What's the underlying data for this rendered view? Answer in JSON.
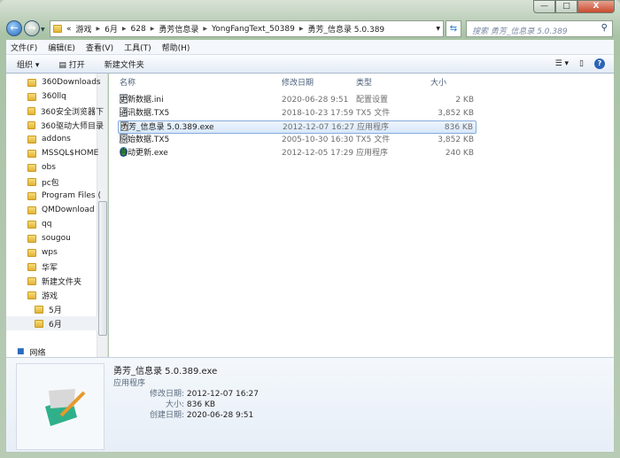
{
  "window": {
    "minimize": "—",
    "maximize": "□",
    "close": "X"
  },
  "address": {
    "overflow": "«",
    "crumbs": [
      "游戏",
      "6月",
      "628",
      "勇芳信息录",
      "YongFangText_50389",
      "勇芳_信息录 5.0.389"
    ]
  },
  "search": {
    "placeholder": "搜索 勇芳_信息录 5.0.389"
  },
  "menu": [
    "文件(F)",
    "编辑(E)",
    "查看(V)",
    "工具(T)",
    "帮助(H)"
  ],
  "toolbar": {
    "organize": "组织 ▾",
    "open": "打开",
    "new_folder": "新建文件夹"
  },
  "nav": {
    "items": [
      "360Downloads",
      "360llq",
      "360安全浏览器下",
      "360驱动大师目录",
      "addons",
      "MSSQL$HOME",
      "obs",
      "pc包",
      "Program Files (",
      "QMDownload",
      "qq",
      "sougou",
      "wps",
      "华军",
      "新建文件夹",
      "游戏"
    ],
    "sub": [
      "5月",
      "6月"
    ],
    "network": "网络"
  },
  "columns": {
    "name": "名称",
    "modified": "修改日期",
    "type": "类型",
    "size": "大小"
  },
  "files": [
    {
      "name": "更新数据.ini",
      "modified": "2020-06-28 9:51",
      "type": "配置设置",
      "size": "2 KB"
    },
    {
      "name": "通讯数据.TX5",
      "modified": "2018-10-23 17:59",
      "type": "TX5 文件",
      "size": "3,852 KB"
    },
    {
      "name": "勇芳_信息录 5.0.389.exe",
      "modified": "2012-12-07 16:27",
      "type": "应用程序",
      "size": "836 KB"
    },
    {
      "name": "原始数据.TX5",
      "modified": "2005-10-30 16:30",
      "type": "TX5 文件",
      "size": "3,852 KB"
    },
    {
      "name": "自动更新.exe",
      "modified": "2012-12-05 17:29",
      "type": "应用程序",
      "size": "240 KB"
    }
  ],
  "details": {
    "name": "勇芳_信息录 5.0.389.exe",
    "type": "应用程序",
    "modified_label": "修改日期:",
    "modified": "2012-12-07 16:27",
    "size_label": "大小:",
    "size": "836 KB",
    "created_label": "创建日期:",
    "created": "2020-06-28 9:51"
  }
}
